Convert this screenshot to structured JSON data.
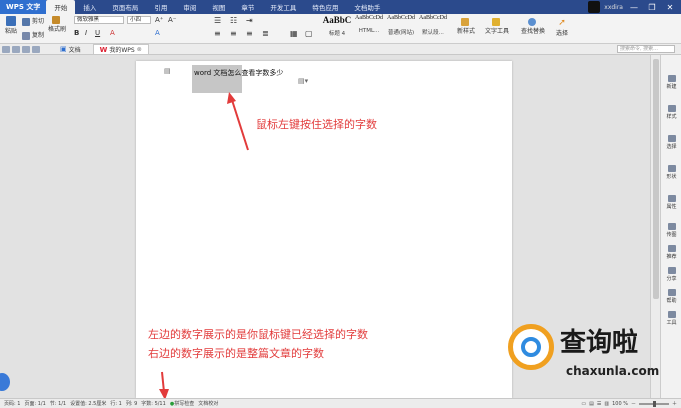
{
  "titlebar": {
    "app_name": "WPS 文字",
    "menus": [
      "开始",
      "插入",
      "页面布局",
      "引用",
      "审阅",
      "视图",
      "章节",
      "开发工具",
      "特色应用",
      "文档助手"
    ],
    "user_name": "xxdira",
    "controls": [
      "—",
      "❐",
      "✕"
    ]
  },
  "ribbon": {
    "paste": "粘贴",
    "cut": "剪切",
    "copy": "复制",
    "format_painter": "格式刷",
    "font_name": "微软雅黑",
    "font_size": "小四",
    "styles": [
      {
        "sample": "AaBbC",
        "name": "标题 4"
      },
      {
        "sample": "AaBbCcDd",
        "name": "HTML..."
      },
      {
        "sample": "AaBbCcDd",
        "name": "普通(网站)"
      },
      {
        "sample": "AaBbCcDd",
        "name": "默认段..."
      }
    ],
    "new_style": "新样式",
    "text_tools": "文字工具",
    "find_replace": "查找替换",
    "select": "选择"
  },
  "tabbar": {
    "tabs": [
      "文档",
      "我的WPS"
    ],
    "search_placeholder": "搜索命令, 搜索..."
  },
  "document": {
    "text": "word 文档怎么查看字数多少",
    "selected_part": "word 文档怎么"
  },
  "annotations": {
    "top": "鼠标左键按住选择的字数",
    "bottom_line1": "左边的数字展示的是你鼠标键已经选择的字数",
    "bottom_line2": "右边的数字展示的是整篇文章的字数"
  },
  "sidepanel": [
    "新建",
    "样式",
    "选择",
    "形状",
    "属性",
    "传图",
    "推荐",
    "分享",
    "帮助",
    "工具"
  ],
  "statusbar": {
    "page": "页码: 1",
    "pages": "页面: 1/1",
    "section": "节: 1/1",
    "position": "设置值: 2.5厘米",
    "line": "行: 1",
    "column": "列: 9",
    "word_count": "字数: 5/11",
    "spell_check": "拼写检查",
    "doc_check": "文档校对",
    "zoom": "100 %"
  },
  "watermark": {
    "text": "查询啦",
    "domain": "chaxunla.com"
  },
  "colors": {
    "titlebar": "#2b4a8c",
    "annotation": "#e23b3b",
    "selection": "#c6c6c6"
  }
}
